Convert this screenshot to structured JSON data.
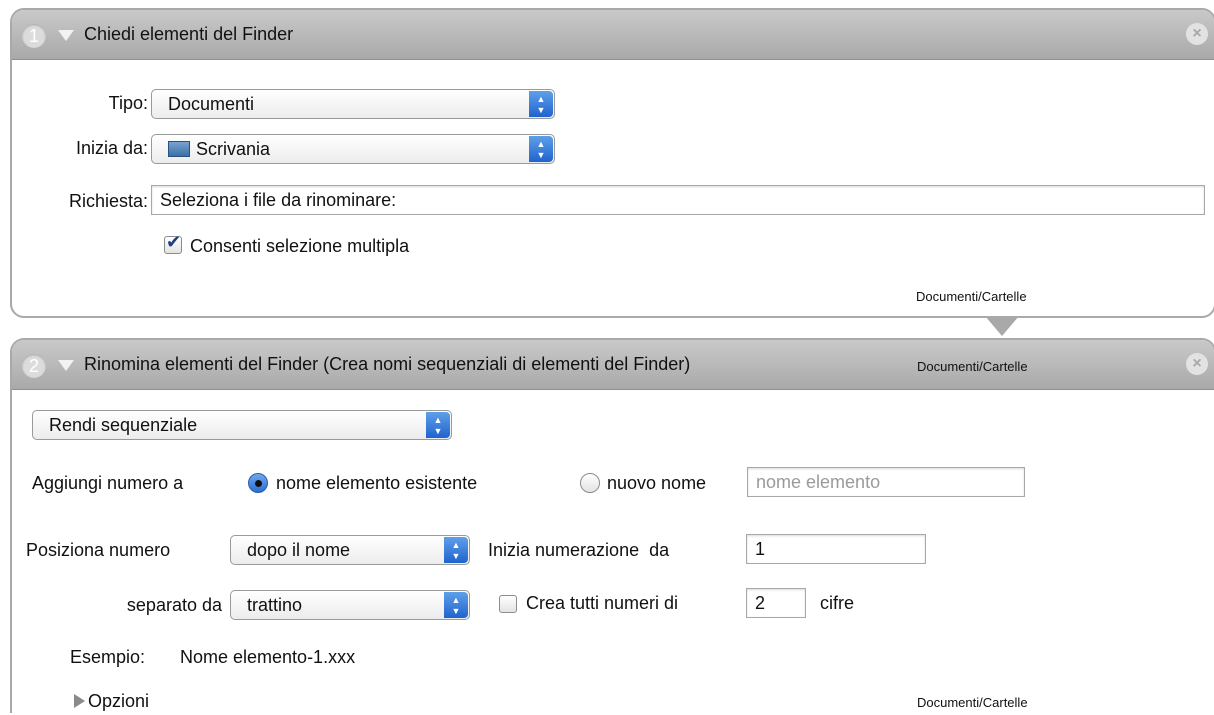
{
  "action1": {
    "number": "1",
    "title": "Chiedi elementi del Finder",
    "close_glyph": "×",
    "tipo_label": "Tipo:",
    "tipo_value": "Documenti",
    "inizia_label": "Inizia da:",
    "inizia_value": "Scrivania",
    "inizia_icon": "desktop-folder-icon",
    "richiesta_label": "Richiesta:",
    "richiesta_value": "Seleziona i file da rinominare:",
    "multi_label": "Consenti selezione multipla",
    "multi_checked": true,
    "output": "Documenti/Cartelle"
  },
  "action2": {
    "number": "2",
    "title": "Rinomina elementi del Finder (Crea nomi sequenziali di elementi del Finder)",
    "input": "Documenti/Cartelle",
    "close_glyph": "×",
    "mode_value": "Rendi sequenziale",
    "aggiungi_label": "Aggiungi numero a",
    "radio_existing_label": "nome elemento esistente",
    "radio_new_label": "nuovo nome",
    "new_name_placeholder": "nome elemento",
    "posiziona_label": "Posiziona numero",
    "posiziona_value": "dopo il nome",
    "inizia_num_label": "Inizia numerazione  da",
    "inizia_num_value": "1",
    "separato_label": "separato da",
    "separato_value": "trattino",
    "crea_label": "Crea tutti numeri di",
    "cifre_value": "2",
    "cifre_label": "cifre",
    "esempio_label": "Esempio:",
    "esempio_value": "Nome elemento-1.xxx",
    "opzioni_label": "Opzioni",
    "output": "Documenti/Cartelle"
  },
  "colors": {
    "header_gray": "#a9a9a9",
    "popup_blue": "#2a6fd3"
  }
}
